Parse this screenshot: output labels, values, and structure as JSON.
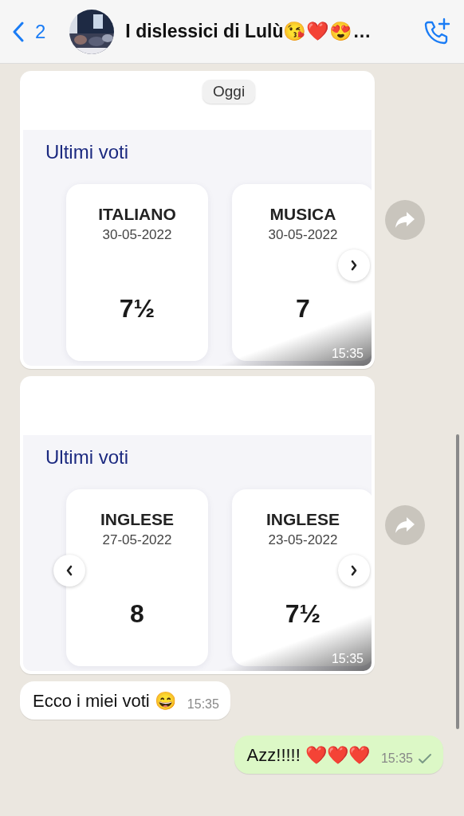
{
  "header": {
    "back_count": "2",
    "title": "I dislessici di Lulù😘❤️😍…"
  },
  "date_pill": "Oggi",
  "messages": [
    {
      "heading": "Ultimi voti",
      "cards": [
        {
          "subject": "ITALIANO",
          "date": "30-05-2022",
          "grade": "7½"
        },
        {
          "subject": "MUSICA",
          "date": "30-05-2022",
          "grade": "7"
        }
      ],
      "nav": {
        "prev": false,
        "next": true
      },
      "time": "15:35"
    },
    {
      "heading": "Ultimi voti",
      "cards": [
        {
          "subject": "INGLESE",
          "date": "27-05-2022",
          "grade": "8"
        },
        {
          "subject": "INGLESE",
          "date": "23-05-2022",
          "grade": "7½"
        }
      ],
      "nav": {
        "prev": true,
        "next": true
      },
      "time": "15:35"
    },
    {
      "kind": "text",
      "outgoing": false,
      "text": "Ecco i miei voti 😄",
      "time": "15:35"
    },
    {
      "kind": "text",
      "outgoing": true,
      "text": "Azz!!!!! ❤️❤️❤️",
      "time": "15:35",
      "sent": true
    }
  ]
}
